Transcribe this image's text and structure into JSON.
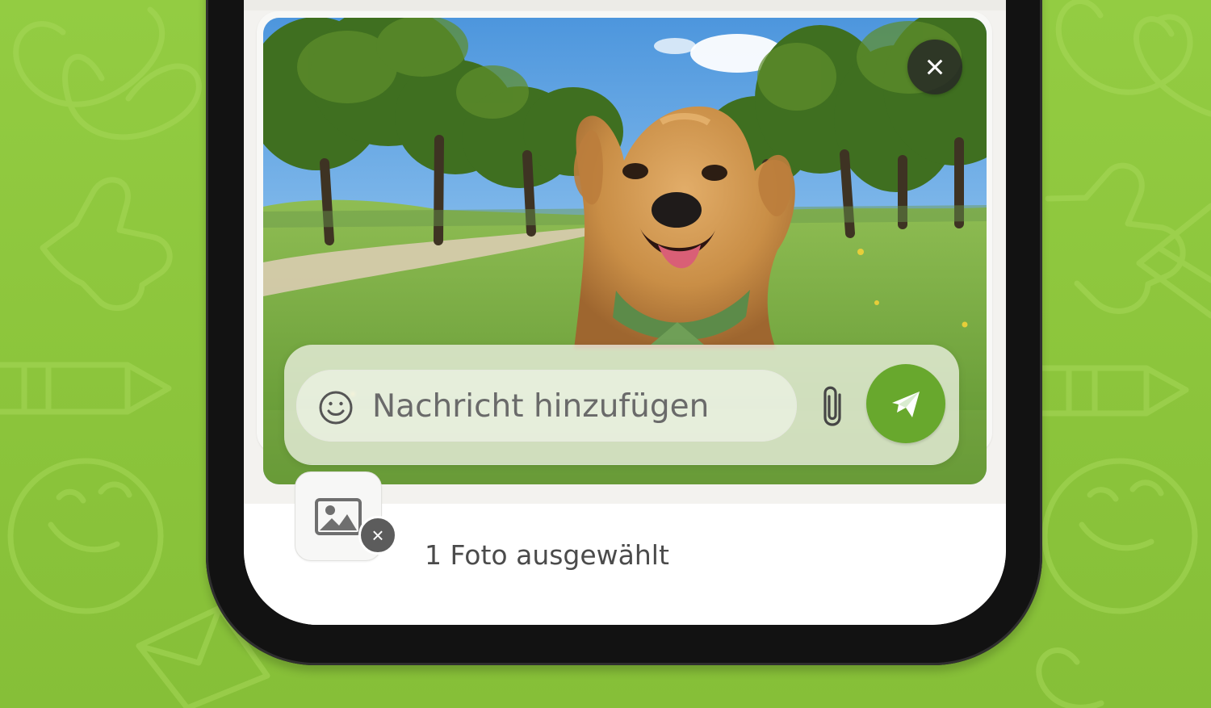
{
  "background": {
    "color": "#8cc63f",
    "pattern_icons": [
      "heart-icon",
      "thumbs-up-icon",
      "pencil-icon",
      "smiley-icon",
      "envelope-icon"
    ]
  },
  "media_preview": {
    "image_subject": "Golden Retriever im Park",
    "close_label": "×"
  },
  "composer": {
    "placeholder": "Nachricht hinzufügen",
    "value": "",
    "icons": {
      "emoji": "smiley-icon",
      "attach": "paperclip-icon",
      "send": "paper-plane-icon"
    },
    "send_color": "#68a82d"
  },
  "selection": {
    "label": "1 Foto ausgewählt",
    "remove_label": "×",
    "thumbnail_icon": "image-icon"
  }
}
